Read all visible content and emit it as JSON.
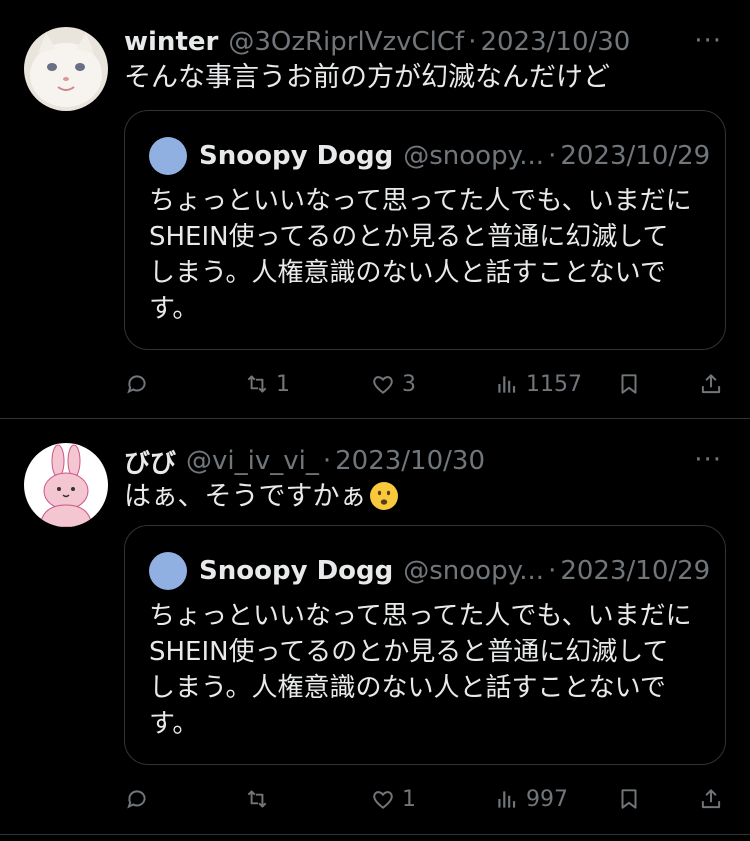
{
  "tweets": [
    {
      "name": "winter",
      "handle": "@3OzRiprlVzvClCf",
      "dot": "·",
      "date": "2023/10/30",
      "more": "···",
      "text": "そんな事言うお前の方が幻滅なんだけど",
      "avatar_icon": "white-cat-avatar",
      "quote": {
        "name": "Snoopy Dogg",
        "handle": "@snoopy...",
        "dot": "·",
        "date": "2023/10/29",
        "lines": [
          "ちょっといいなって思ってた人でも、いまだに",
          "SHEIN使ってるのとか見ると普通に幻滅して",
          "しまう。人権意識のない人と話すことないで",
          "す。"
        ]
      },
      "stats": {
        "retweets": "1",
        "likes": "3",
        "views": "1157"
      }
    },
    {
      "name": "びび",
      "handle": "@vi_iv_vi_",
      "dot": "·",
      "date": "2023/10/30",
      "more": "···",
      "text": "はぁ、そうですかぁ",
      "emoji": "frowning-face-emoji",
      "avatar_icon": "pink-rabbit-avatar",
      "quote": {
        "name": "Snoopy Dogg",
        "handle": "@snoopy...",
        "dot": "·",
        "date": "2023/10/29",
        "lines": [
          "ちょっといいなって思ってた人でも、いまだに",
          "SHEIN使ってるのとか見ると普通に幻滅して",
          "しまう。人権意識のない人と話すことないで",
          "す。"
        ]
      },
      "stats": {
        "retweets": "",
        "likes": "1",
        "views": "997"
      }
    }
  ],
  "colors": {
    "background": "#000000",
    "text": "#e7e9ea",
    "muted": "#71767b",
    "border": "#2f3336"
  }
}
